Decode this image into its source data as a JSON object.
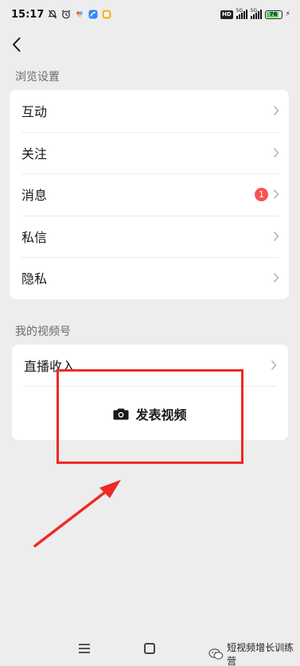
{
  "status_bar": {
    "time": "15:17",
    "icons": [
      "mute-alarm-icon",
      "alarm-clock-icon",
      "app-icon-colorful",
      "app-icon-blue",
      "app-icon-orange"
    ],
    "hd_badge": "HD",
    "network_1": "5G",
    "network_2": "5G",
    "battery_level": "76"
  },
  "header": {
    "back_icon": "chevron-left-icon"
  },
  "browse_settings": {
    "title": "浏览设置",
    "items": [
      {
        "label": "互动",
        "badge": null
      },
      {
        "label": "关注",
        "badge": null
      },
      {
        "label": "消息",
        "badge": "1"
      },
      {
        "label": "私信",
        "badge": null
      },
      {
        "label": "隐私",
        "badge": null
      }
    ]
  },
  "my_channel": {
    "title": "我的视频号",
    "live_income_label": "直播收入",
    "post_video_label": "发表视频",
    "post_video_icon": "camera-icon"
  },
  "nav_bar": {
    "menu_icon": "menu-lines-icon",
    "home_icon": "square-home-icon"
  },
  "watermark": {
    "text": "短视频增长训练营"
  },
  "colors": {
    "background": "#ededed",
    "card": "#ffffff",
    "badge_red": "#fa5151",
    "annotation_red": "#ee2a24",
    "battery_green": "#4cd964"
  }
}
